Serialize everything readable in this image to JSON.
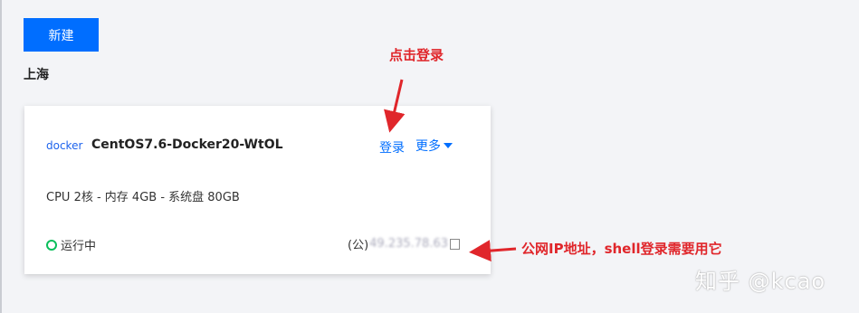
{
  "toolbar": {
    "new_label": "新建"
  },
  "region": "上海",
  "instance": {
    "logo_text": "docker",
    "name": "CentOS7.6-Docker20-WtOL",
    "login_label": "登录",
    "more_label": "更多",
    "spec": "CPU 2核 - 内存 4GB - 系统盘 80GB",
    "status": "运行中",
    "ip_prefix": "(公)",
    "ip_value": "49.235.78.63"
  },
  "annotations": {
    "login_hint": "点击登录",
    "ip_hint": "公网IP地址，shell登录需要用它"
  },
  "watermark": "知乎 @kcao",
  "colors": {
    "accent": "#006eff",
    "annotation": "#e0262b",
    "status_ok": "#0abf5b"
  }
}
